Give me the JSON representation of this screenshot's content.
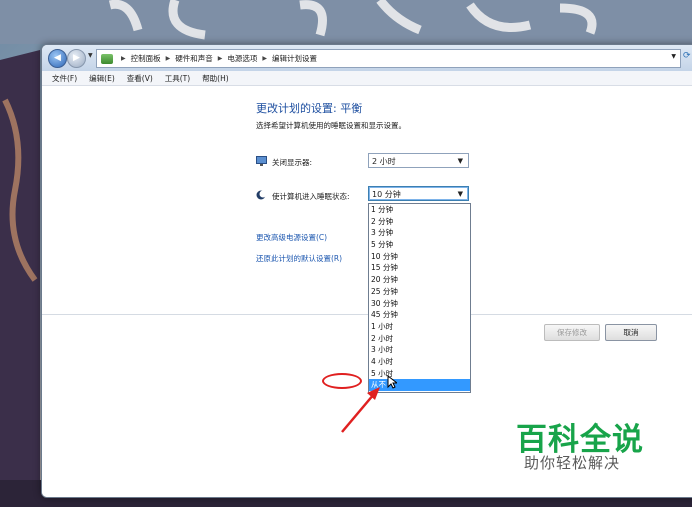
{
  "breadcrumb": [
    "控制面板",
    "硬件和声音",
    "电源选项",
    "编辑计划设置"
  ],
  "menu": [
    "文件(F)",
    "编辑(E)",
    "查看(V)",
    "工具(T)",
    "帮助(H)"
  ],
  "page": {
    "title": "更改计划的设置: 平衡",
    "subtitle": "选择希望计算机使用的睡眠设置和显示设置。",
    "display_label": "关闭显示器:",
    "display_value": "2 小时",
    "sleep_label": "使计算机进入睡眠状态:",
    "sleep_value": "10 分钟",
    "advanced_link": "更改高级电源设置(C)",
    "restore_link": "还原此计划的默认设置(R)",
    "save_button": "保存修改",
    "cancel_button": "取消"
  },
  "dropdown_options": [
    "1 分钟",
    "2 分钟",
    "3 分钟",
    "5 分钟",
    "10 分钟",
    "15 分钟",
    "20 分钟",
    "25 分钟",
    "30 分钟",
    "45 分钟",
    "1 小时",
    "2 小时",
    "3 小时",
    "4 小时",
    "5 小时",
    "从不"
  ],
  "dropdown_selected": "从不",
  "watermark": {
    "title": "百科全说",
    "subtitle": "助你轻松解决"
  },
  "colors": {
    "accent": "#1e58b0",
    "selection": "#3399ff",
    "annotation": "#e02020",
    "watermark": "#18a44a"
  }
}
